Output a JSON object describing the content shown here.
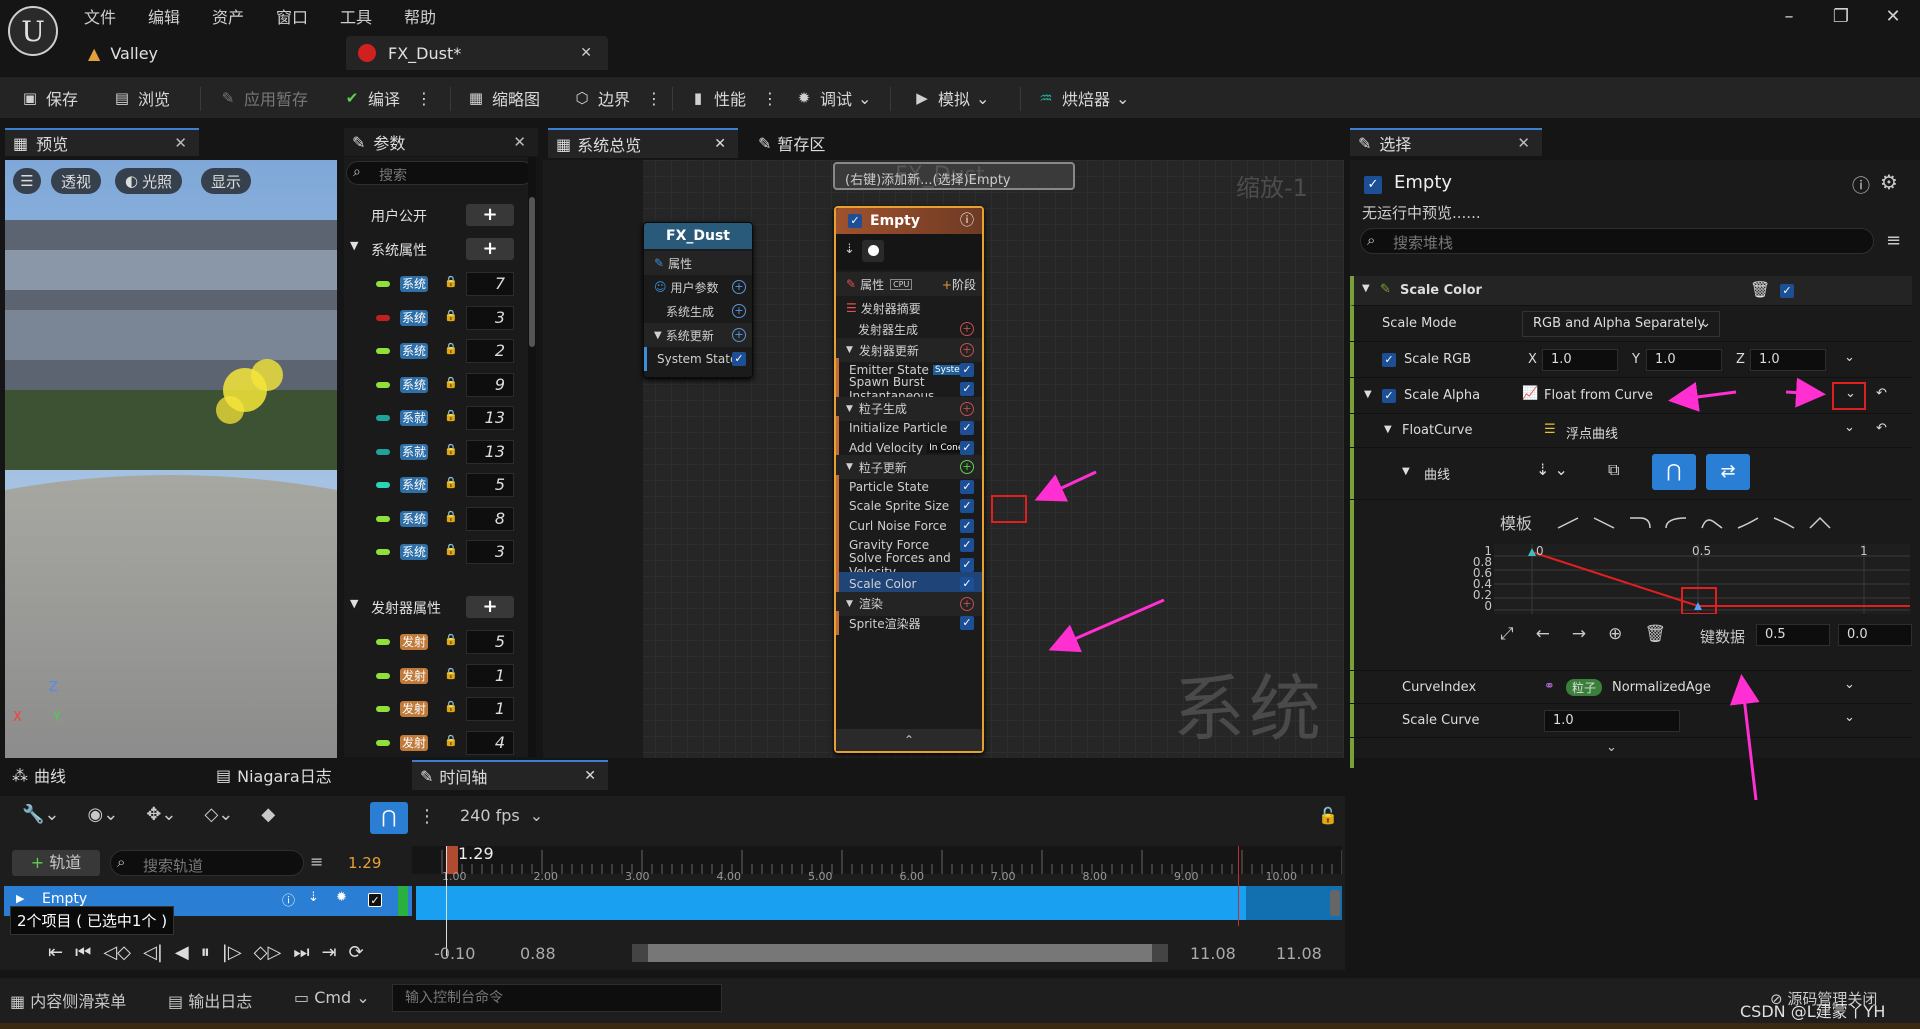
{
  "app": {
    "menu": [
      "文件",
      "编辑",
      "资产",
      "窗口",
      "工具",
      "帮助"
    ],
    "tabs": [
      {
        "label": "Valley"
      },
      {
        "label": "FX_Dust*"
      }
    ]
  },
  "toolbar": {
    "save": "保存",
    "browse": "浏览",
    "apply": "应用暂存",
    "compile": "编译",
    "thumbnail": "缩略图",
    "bounds": "边界",
    "perf": "性能",
    "debug": "调试",
    "simulate": "模拟",
    "baker": "烘焙器"
  },
  "preview": {
    "title": "预览",
    "buttons": [
      "透视",
      "光照",
      "显示"
    ],
    "axes": {
      "x": "X",
      "y": "Y",
      "z": "Z"
    }
  },
  "params": {
    "title": "参数",
    "search_placeholder": "搜索",
    "user_exposed": "用户公开",
    "system_attrs": "系统属性",
    "emitter_attrs": "发射器属性",
    "system_rows": [
      {
        "label": "系统",
        "value": "7",
        "color": "#8fe03a"
      },
      {
        "label": "系统",
        "value": "3",
        "color": "#c02020"
      },
      {
        "label": "系统",
        "value": "2",
        "color": "#8fe03a"
      },
      {
        "label": "系统",
        "value": "9",
        "color": "#8fe03a"
      },
      {
        "label": "系就",
        "value": "13",
        "color": "#1fa39a"
      },
      {
        "label": "系就",
        "value": "13",
        "color": "#1fa39a"
      },
      {
        "label": "系统",
        "value": "5",
        "color": "#2ad4b4"
      },
      {
        "label": "系统",
        "value": "8",
        "color": "#8fe03a"
      },
      {
        "label": "系统",
        "value": "3",
        "color": "#8fe03a"
      }
    ],
    "emitter_rows": [
      {
        "label": "发射",
        "value": "5",
        "color": "#8fe03a"
      },
      {
        "label": "发射",
        "value": "1",
        "color": "#8fe03a"
      },
      {
        "label": "发射",
        "value": "1",
        "color": "#8fe03a"
      },
      {
        "label": "发射",
        "value": "4",
        "color": "#8fe03a"
      }
    ]
  },
  "graph": {
    "tab_overview": "系统总览",
    "tab_scratch": "暂存区",
    "title": "FX_Dust",
    "hint": "(右键)添加新...(选择)Empty",
    "zoom": "缩放-1",
    "watermark": "系统",
    "system_node": {
      "title": "FX_Dust",
      "rows": [
        {
          "label": "属性"
        },
        {
          "label": "用户参数"
        },
        {
          "label": "系统生成"
        },
        {
          "label": "系统更新"
        },
        {
          "label": "System State"
        }
      ]
    },
    "emitter_node": {
      "title": "Empty",
      "attr_label": "属性",
      "cpu": "CPU",
      "stage": "阶段",
      "rows": [
        {
          "label": "发射器摘要",
          "kind": "plain"
        },
        {
          "label": "发射器生成",
          "kind": "sub"
        },
        {
          "label": "发射器更新",
          "kind": "section"
        },
        {
          "label": "Emitter State",
          "badge": "System",
          "kind": "module"
        },
        {
          "label": "Spawn Burst Instantaneous",
          "kind": "module"
        },
        {
          "label": "粒子生成",
          "kind": "section"
        },
        {
          "label": "Initialize Particle",
          "kind": "module"
        },
        {
          "label": "Add Velocity",
          "badge": "In Cone",
          "kind": "module"
        },
        {
          "label": "粒子更新",
          "kind": "section"
        },
        {
          "label": "Particle State",
          "kind": "module"
        },
        {
          "label": "Scale Sprite Size",
          "kind": "module"
        },
        {
          "label": "Curl Noise Force",
          "kind": "module"
        },
        {
          "label": "Gravity Force",
          "kind": "module"
        },
        {
          "label": "Solve Forces and Velocity",
          "kind": "module"
        },
        {
          "label": "Scale Color",
          "kind": "selected"
        },
        {
          "label": "渲染",
          "kind": "section"
        },
        {
          "label": "Sprite渲染器",
          "kind": "module"
        }
      ]
    }
  },
  "details": {
    "tab": "选择",
    "emitter": "Empty",
    "no_preview": "无运行中预览......",
    "search_placeholder": "搜索堆栈",
    "module": "Scale Color",
    "scale_mode_label": "Scale Mode",
    "scale_mode_value": "RGB and Alpha Separately",
    "scale_rgb_label": "Scale RGB",
    "rgb": {
      "x": "1.0",
      "y": "1.0",
      "z": "1.0"
    },
    "axis_labels": {
      "x": "X",
      "y": "Y",
      "z": "Z"
    },
    "scale_alpha_label": "Scale Alpha",
    "scale_alpha_value": "Float from Curve",
    "float_curve_label": "FloatCurve",
    "float_curve_value": "浮点曲线",
    "curve_label": "曲线",
    "template_label": "模板",
    "curve_ticks_x": [
      "0",
      "0.5",
      "1"
    ],
    "curve_ticks_y": [
      "1",
      "0.8",
      "0.6",
      "0.4",
      "0.2",
      "0"
    ],
    "key_label": "键数据",
    "key_time": "0.5",
    "key_value": "0.0",
    "curve_index_label": "CurveIndex",
    "curve_index_badge": "粒子",
    "curve_index_value": "NormalizedAge",
    "scale_curve_label": "Scale Curve",
    "scale_curve_value": "1.0"
  },
  "bottom": {
    "tabs": [
      "曲线",
      "Niagara日志",
      "时间轴"
    ],
    "fps": "240 fps",
    "add_track": "轨道",
    "search_tracks": "搜索轨道",
    "current_time": "1.29",
    "playhead_label": "1.29",
    "ruler": [
      "1.00",
      "2.00",
      "3.00",
      "4.00",
      "5.00",
      "6.00",
      "7.00",
      "8.00",
      "9.00",
      "10.00"
    ],
    "track": "Empty",
    "items_status": "2个项目 ( 已选中1个 )",
    "range_start": "-0.10",
    "range_current": "0.88",
    "range_end1": "11.08",
    "range_end2": "11.08"
  },
  "statusbar": {
    "content_drawer": "内容侧滑菜单",
    "output_log": "输出日志",
    "cmd": "Cmd",
    "console_placeholder": "输入控制台命令",
    "source_control": "源码管理关闭",
    "watermark": "CSDN @L建蒙丫YH"
  },
  "colors": {
    "accent": "#2a7fd4",
    "annotation": "#ff2fd2",
    "highlight": "#e02020"
  }
}
